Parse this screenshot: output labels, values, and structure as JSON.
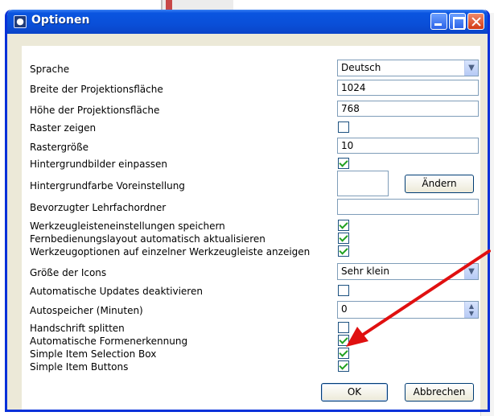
{
  "window": {
    "title": "Optionen",
    "icon_name": "app-logo-icon"
  },
  "colors": {
    "titlebar": "#0a55e0",
    "dialog_bg": "#ece9d8",
    "checkmark": "#21a121",
    "annotation_arrow": "#e01010"
  },
  "options": {
    "language": {
      "label": "Sprache",
      "value": "Deutsch"
    },
    "projection_width": {
      "label": "Breite der Projektionsfläche",
      "value": "1024"
    },
    "projection_height": {
      "label": "Höhe der Projektionsfläche",
      "value": "768"
    },
    "show_grid": {
      "label": "Raster zeigen",
      "checked": false
    },
    "grid_size": {
      "label": "Rastergröße",
      "value": "10"
    },
    "fit_backgrounds": {
      "label": "Hintergrundbilder einpassen",
      "checked": true
    },
    "background_color": {
      "label": "Hintergrundfarbe Voreinstellung",
      "button": "Ändern"
    },
    "teacher_folder": {
      "label": "Bevorzugter Lehrfachordner",
      "value": ""
    },
    "save_toolbar_settings": {
      "label": "Werkzeugleisteneinstellungen speichern",
      "checked": true
    },
    "remote_layout_update": {
      "label": "Fernbedienungslayout automatisch aktualisieren",
      "checked": true
    },
    "tool_options_single_toolbar": {
      "label": "Werkzeugoptionen auf einzelner Werkzeugleiste anzeigen",
      "checked": true
    },
    "icon_size": {
      "label": "Größe der Icons",
      "value": "Sehr klein"
    },
    "disable_auto_updates": {
      "label": "Automatische Updates deaktivieren",
      "checked": false
    },
    "autosave_minutes": {
      "label": "Autospeicher (Minuten)",
      "value": "0"
    },
    "split_handwriting": {
      "label": "Handschrift splitten",
      "checked": false
    },
    "auto_shape_recognition": {
      "label": "Automatische Formenerkennung",
      "checked": true
    },
    "simple_item_selection_box": {
      "label": "Simple Item Selection Box",
      "checked": true
    },
    "simple_item_buttons": {
      "label": "Simple Item Buttons",
      "checked": true
    }
  },
  "footer": {
    "ok_label": "OK",
    "cancel_label": "Abbrechen"
  }
}
